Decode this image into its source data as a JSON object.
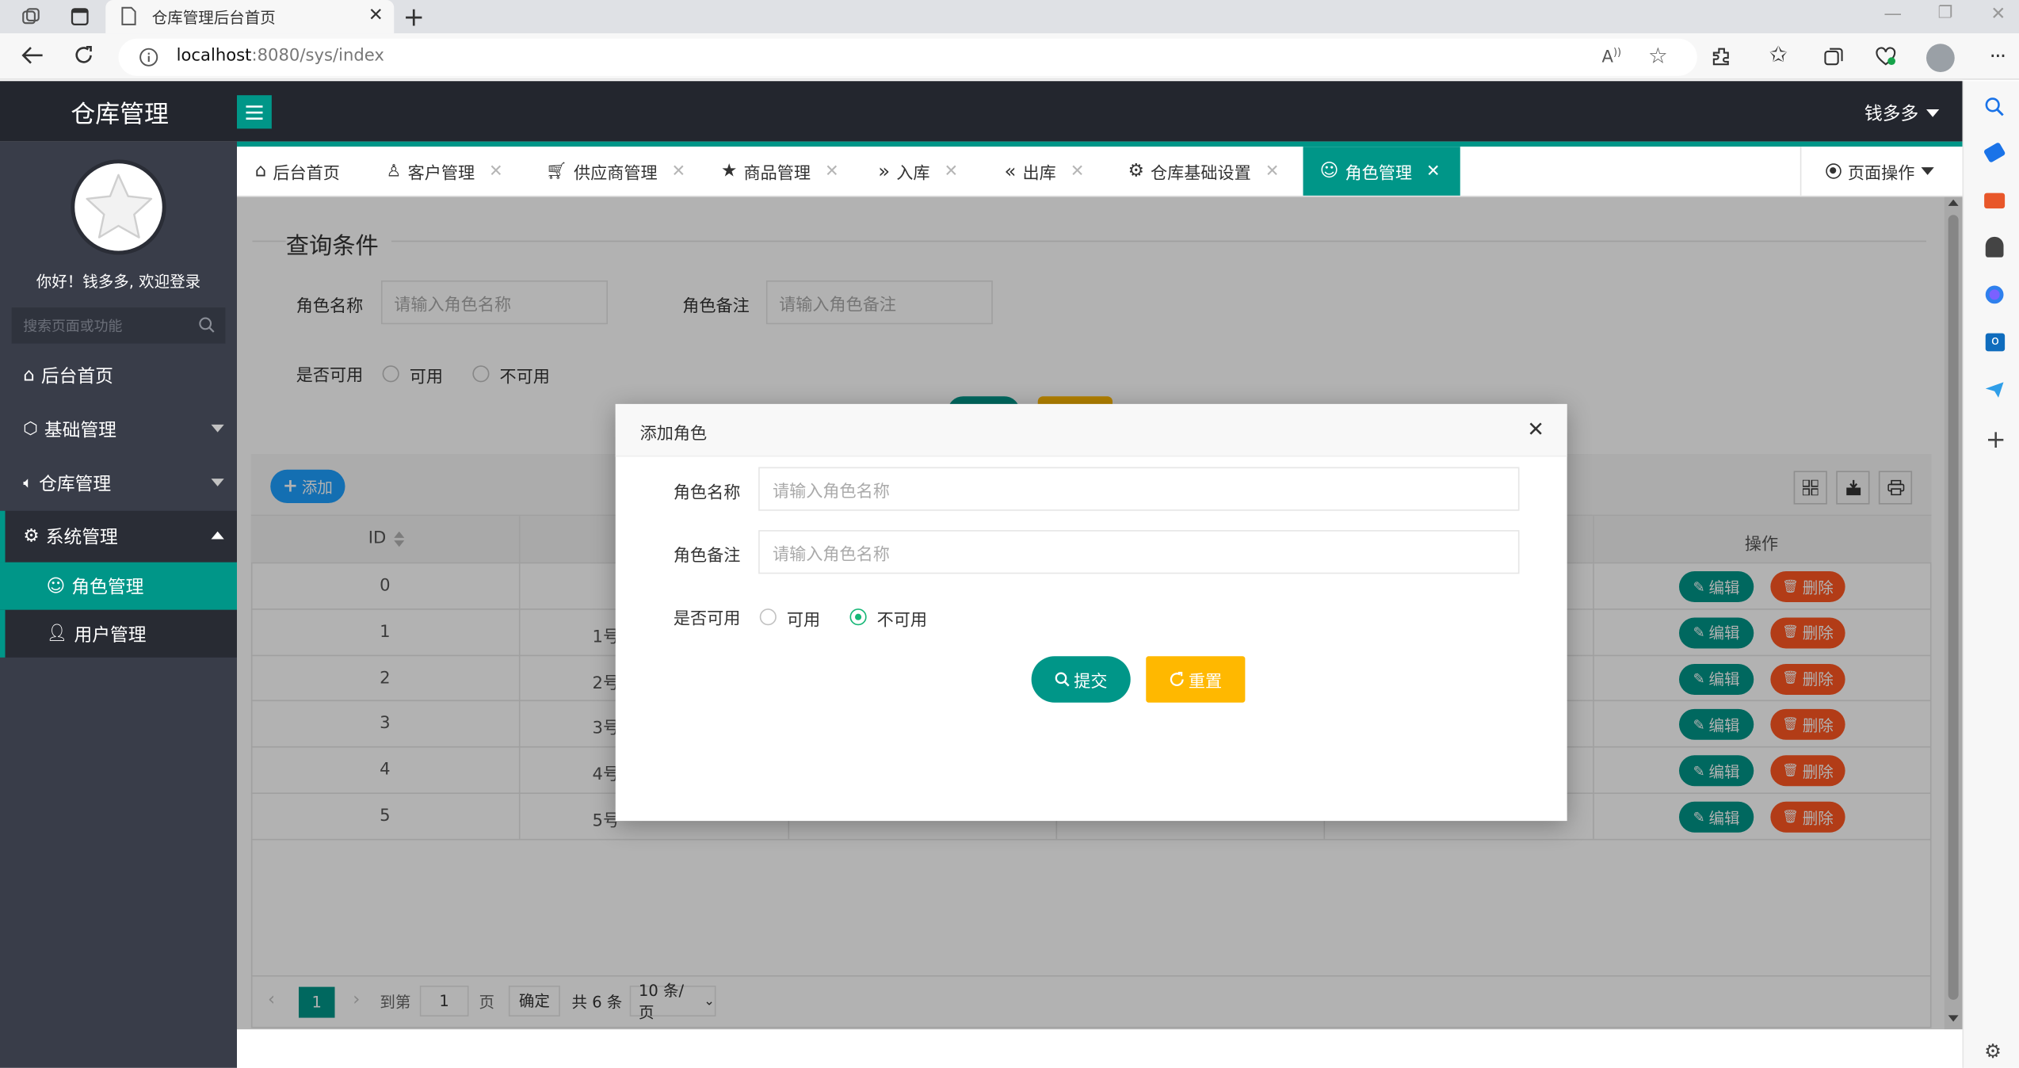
{
  "browser": {
    "tab_title": "仓库管理后台首页",
    "url_host": "localhost",
    "url_path": ":8080/sys/index"
  },
  "app": {
    "logo": "仓库管理",
    "user_name": "钱多多",
    "welcome": "你好！钱多多, 欢迎登录",
    "search_placeholder": "搜索页面或功能",
    "page_ops": "页面操作"
  },
  "sidebar": {
    "items": [
      {
        "label": "后台首页"
      },
      {
        "label": "基础管理"
      },
      {
        "label": "仓库管理"
      },
      {
        "label": "系统管理"
      }
    ],
    "sub_items": [
      {
        "label": "角色管理"
      },
      {
        "label": "用户管理"
      }
    ]
  },
  "tabs": [
    {
      "label": "后台首页"
    },
    {
      "label": "客户管理"
    },
    {
      "label": "供应商管理"
    },
    {
      "label": "商品管理"
    },
    {
      "label": "入库"
    },
    {
      "label": "出库"
    },
    {
      "label": "仓库基础设置"
    },
    {
      "label": "角色管理"
    }
  ],
  "query": {
    "title": "查询条件",
    "name_label": "角色名称",
    "name_placeholder": "请输入角色名称",
    "remark_label": "角色备注",
    "remark_placeholder": "请输入角色备注",
    "avail_label": "是否可用",
    "opt_yes": "可用",
    "opt_no": "不可用"
  },
  "table": {
    "add_label": "添加",
    "col_id": "ID",
    "col_ops": "操作",
    "edit_label": "编辑",
    "delete_label": "删除",
    "ids": [
      "0",
      "1",
      "2",
      "3",
      "4",
      "5"
    ],
    "name_fragments": [
      "",
      "1号",
      "2号",
      "3号",
      "4号",
      "5号"
    ]
  },
  "pager": {
    "current": "1",
    "goto": "到第",
    "page_input": "1",
    "page_unit": "页",
    "confirm": "确定",
    "total": "共 6 条",
    "per_page": "10 条/页"
  },
  "modal": {
    "title": "添加角色",
    "name_label": "角色名称",
    "name_placeholder": "请输入角色名称",
    "remark_label": "角色备注",
    "remark_placeholder": "请输入角色名称",
    "avail_label": "是否可用",
    "opt_yes": "可用",
    "opt_no": "不可用",
    "submit": "提交",
    "reset": "重置"
  },
  "colors": {
    "accent": "#009688",
    "danger": "#ff5722",
    "warn": "#ffb800",
    "topbar": "#23262e",
    "sidebar": "#393d49"
  }
}
